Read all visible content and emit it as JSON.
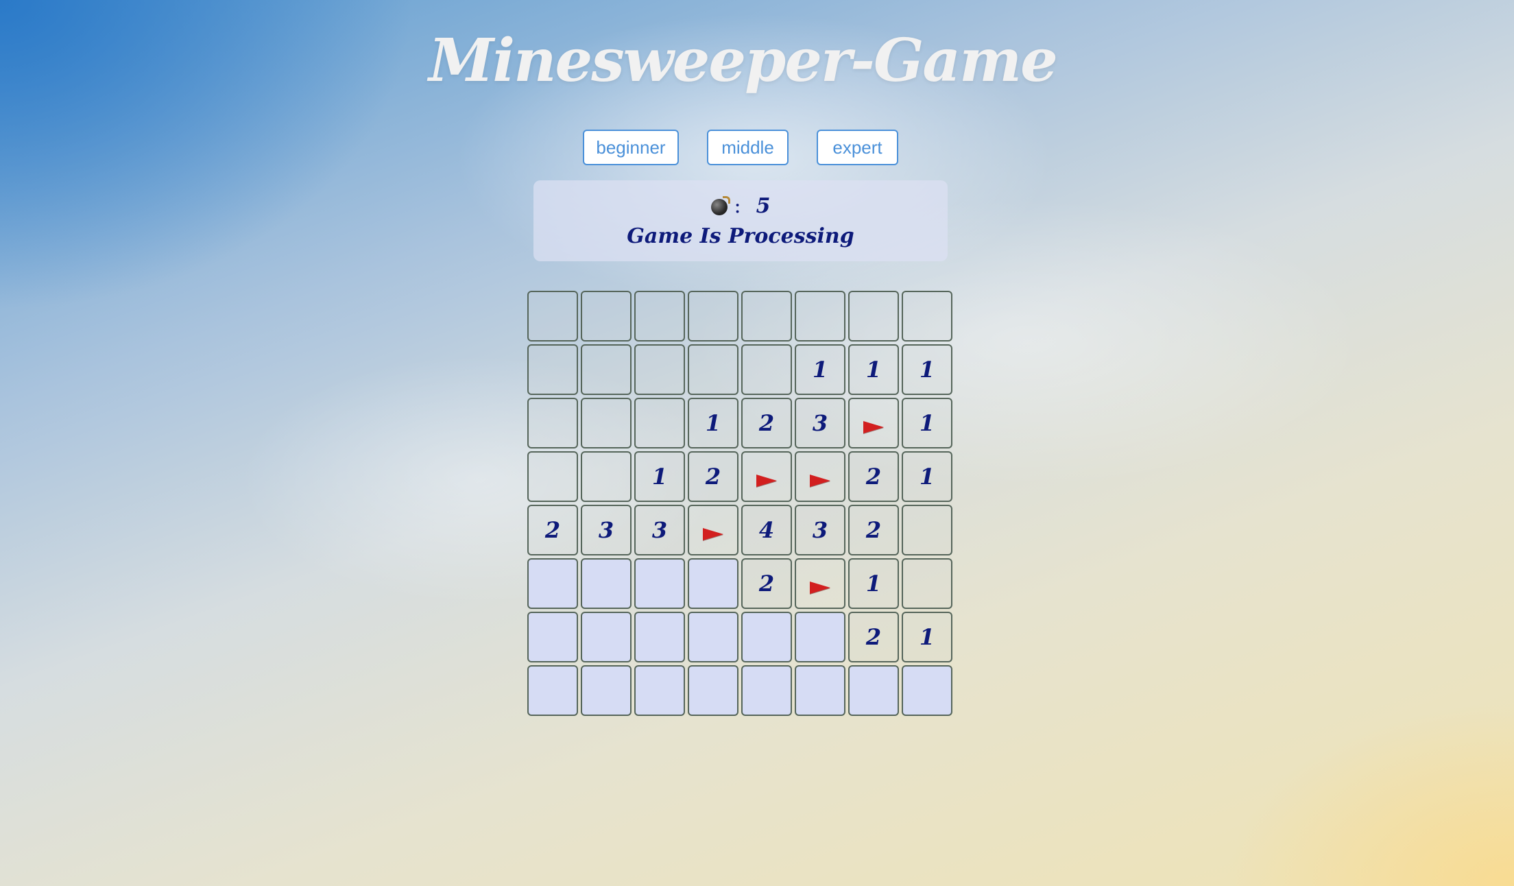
{
  "title": "Minesweeper-Game",
  "levels": {
    "beginner": "beginner",
    "middle": "middle",
    "expert": "expert"
  },
  "status": {
    "mine_icon": "bomb-icon",
    "separator": ":",
    "mine_count": "5",
    "message": "Game Is Processing"
  },
  "colors": {
    "accent": "#4a90d9",
    "text": "#0d1a7a",
    "flag": "#d21f1f",
    "hidden_cell": "#d6dcf4"
  },
  "board": {
    "rows": 8,
    "cols": 8,
    "cells": [
      [
        {
          "state": "revealed",
          "value": ""
        },
        {
          "state": "revealed",
          "value": ""
        },
        {
          "state": "revealed",
          "value": ""
        },
        {
          "state": "revealed",
          "value": ""
        },
        {
          "state": "revealed",
          "value": ""
        },
        {
          "state": "revealed",
          "value": ""
        },
        {
          "state": "revealed",
          "value": ""
        },
        {
          "state": "revealed",
          "value": ""
        }
      ],
      [
        {
          "state": "revealed",
          "value": ""
        },
        {
          "state": "revealed",
          "value": ""
        },
        {
          "state": "revealed",
          "value": ""
        },
        {
          "state": "revealed",
          "value": ""
        },
        {
          "state": "revealed",
          "value": ""
        },
        {
          "state": "revealed",
          "value": "1"
        },
        {
          "state": "revealed",
          "value": "1"
        },
        {
          "state": "revealed",
          "value": "1"
        }
      ],
      [
        {
          "state": "revealed",
          "value": ""
        },
        {
          "state": "revealed",
          "value": ""
        },
        {
          "state": "revealed",
          "value": ""
        },
        {
          "state": "revealed",
          "value": "1"
        },
        {
          "state": "revealed",
          "value": "2"
        },
        {
          "state": "revealed",
          "value": "3"
        },
        {
          "state": "flagged",
          "value": ""
        },
        {
          "state": "revealed",
          "value": "1"
        }
      ],
      [
        {
          "state": "revealed",
          "value": ""
        },
        {
          "state": "revealed",
          "value": ""
        },
        {
          "state": "revealed",
          "value": "1"
        },
        {
          "state": "revealed",
          "value": "2"
        },
        {
          "state": "flagged",
          "value": ""
        },
        {
          "state": "flagged",
          "value": ""
        },
        {
          "state": "revealed",
          "value": "2"
        },
        {
          "state": "revealed",
          "value": "1"
        }
      ],
      [
        {
          "state": "revealed",
          "value": "2"
        },
        {
          "state": "revealed",
          "value": "3"
        },
        {
          "state": "revealed",
          "value": "3"
        },
        {
          "state": "flagged",
          "value": ""
        },
        {
          "state": "revealed",
          "value": "4"
        },
        {
          "state": "revealed",
          "value": "3"
        },
        {
          "state": "revealed",
          "value": "2"
        },
        {
          "state": "revealed",
          "value": ""
        }
      ],
      [
        {
          "state": "hidden",
          "value": ""
        },
        {
          "state": "hidden",
          "value": ""
        },
        {
          "state": "hidden",
          "value": ""
        },
        {
          "state": "hidden",
          "value": ""
        },
        {
          "state": "revealed",
          "value": "2"
        },
        {
          "state": "flagged",
          "value": ""
        },
        {
          "state": "revealed",
          "value": "1"
        },
        {
          "state": "revealed",
          "value": ""
        }
      ],
      [
        {
          "state": "hidden",
          "value": ""
        },
        {
          "state": "hidden",
          "value": ""
        },
        {
          "state": "hidden",
          "value": ""
        },
        {
          "state": "hidden",
          "value": ""
        },
        {
          "state": "hidden",
          "value": ""
        },
        {
          "state": "hidden",
          "value": ""
        },
        {
          "state": "revealed",
          "value": "2"
        },
        {
          "state": "revealed",
          "value": "1"
        }
      ],
      [
        {
          "state": "hidden",
          "value": ""
        },
        {
          "state": "hidden",
          "value": ""
        },
        {
          "state": "hidden",
          "value": ""
        },
        {
          "state": "hidden",
          "value": ""
        },
        {
          "state": "hidden",
          "value": ""
        },
        {
          "state": "hidden",
          "value": ""
        },
        {
          "state": "hidden",
          "value": ""
        },
        {
          "state": "hidden",
          "value": ""
        }
      ]
    ]
  }
}
